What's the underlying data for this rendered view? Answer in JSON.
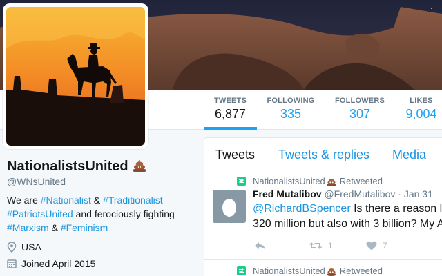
{
  "profile": {
    "name": "NationalistsUnited",
    "screen_name": "@WNsUnited",
    "bio_parts": [
      {
        "text": "We are ",
        "hashtag": false
      },
      {
        "text": "#Nationalist",
        "hashtag": true
      },
      {
        "text": " & ",
        "hashtag": false
      },
      {
        "text": "#Traditionalist",
        "hashtag": true
      },
      {
        "text": "#PatriotsUnited",
        "hashtag": true
      },
      {
        "text": " and ferociously fighting ",
        "hashtag": false
      },
      {
        "text": "#Marxism",
        "hashtag": true
      },
      {
        "text": " & ",
        "hashtag": false
      },
      {
        "text": "#Feminism",
        "hashtag": true
      }
    ],
    "location": "USA",
    "joined": "Joined April 2015"
  },
  "stats": {
    "tweets": {
      "label": "TWEETS",
      "value": "6,877"
    },
    "following": {
      "label": "FOLLOWING",
      "value": "335"
    },
    "followers": {
      "label": "FOLLOWERS",
      "value": "307"
    },
    "likes": {
      "label": "LIKES",
      "value": "9,004"
    }
  },
  "timeline": {
    "tabs": {
      "tweets": "Tweets",
      "replies": "Tweets & replies",
      "media": "Media"
    },
    "retweet_label": "Retweeted",
    "tweet": {
      "fullname": "Fred Mutalibov",
      "handle": "@FredMutalibov",
      "time": "· Jan 31",
      "mention": "@RichardBSpencer",
      "text_line1": " Is there a reason l",
      "text_line2": "320 million but also with 3 billion? My A",
      "retweets": "1",
      "likes": "7"
    }
  },
  "colors": {
    "accent": "#1da1f2",
    "link": "#1b95e0",
    "retweet_green": "#19cf86"
  }
}
